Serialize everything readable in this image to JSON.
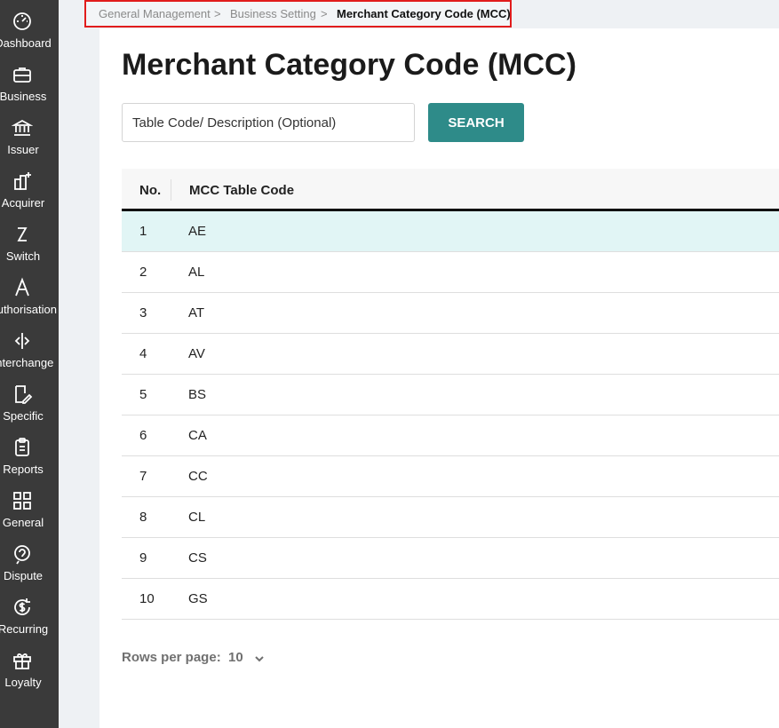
{
  "sidebar": {
    "items": [
      {
        "label": "Dashboard",
        "icon": "dashboard-icon"
      },
      {
        "label": "Business",
        "icon": "briefcase-icon"
      },
      {
        "label": "Issuer",
        "icon": "bank-icon"
      },
      {
        "label": "Acquirer",
        "icon": "building-plus-icon"
      },
      {
        "label": "Switch",
        "icon": "switch-icon"
      },
      {
        "label": "Authorisation",
        "icon": "letter-a-icon"
      },
      {
        "label": "Interchange",
        "icon": "interchange-icon"
      },
      {
        "label": "Specific",
        "icon": "edit-book-icon"
      },
      {
        "label": "Reports",
        "icon": "clipboard-icon"
      },
      {
        "label": "General",
        "icon": "grid-icon"
      },
      {
        "label": "Dispute",
        "icon": "dispute-icon"
      },
      {
        "label": "Recurring",
        "icon": "recurring-dollar-icon"
      },
      {
        "label": "Loyalty",
        "icon": "gift-icon"
      }
    ]
  },
  "breadcrumb": {
    "items": [
      "General Management",
      "Business Setting",
      "Merchant Category Code (MCC)"
    ],
    "separator": ">"
  },
  "page": {
    "title": "Merchant Category Code (MCC)"
  },
  "search": {
    "placeholder": "Table Code/ Description (Optional)",
    "value": "",
    "button_label": "SEARCH"
  },
  "table": {
    "headers": [
      "No.",
      "MCC Table Code"
    ],
    "rows": [
      {
        "no": "1",
        "code": "AE"
      },
      {
        "no": "2",
        "code": "AL"
      },
      {
        "no": "3",
        "code": "AT"
      },
      {
        "no": "4",
        "code": "AV"
      },
      {
        "no": "5",
        "code": "BS"
      },
      {
        "no": "6",
        "code": "CA"
      },
      {
        "no": "7",
        "code": "CC"
      },
      {
        "no": "8",
        "code": "CL"
      },
      {
        "no": "9",
        "code": "CS"
      },
      {
        "no": "10",
        "code": "GS"
      }
    ]
  },
  "pagination": {
    "rows_per_page_label": "Rows per page:",
    "rows_per_page_value": "10"
  },
  "colors": {
    "sidebar_bg": "#3a3a3a",
    "accent": "#2e8b89",
    "selected_row": "#e1f5f5",
    "breadcrumb_highlight": "#e11c1c"
  }
}
